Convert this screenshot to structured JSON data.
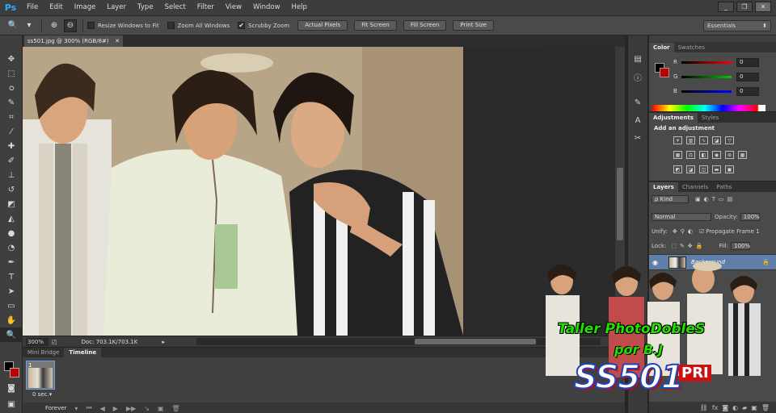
{
  "app": {
    "logo": "Ps"
  },
  "menu": [
    "File",
    "Edit",
    "Image",
    "Layer",
    "Type",
    "Select",
    "Filter",
    "View",
    "Window",
    "Help"
  ],
  "window_controls": {
    "minimize": "_",
    "restore": "❐",
    "close": "✕"
  },
  "options": {
    "resize_windows_label": "Resize Windows to Fit",
    "zoom_all_label": "Zoom All Windows",
    "scrubby_zoom_label": "Scrubby Zoom",
    "scrubby_zoom_checked": "✔",
    "actual_pixels": "Actual Pixels",
    "fit_screen": "Fit Screen",
    "fill_screen": "Fill Screen",
    "print_size": "Print Size",
    "workspace": "Essentials"
  },
  "document": {
    "tab_title": "ss501.jpg @ 300% (RGB/8#)",
    "close": "✕"
  },
  "status": {
    "zoom": "300%",
    "doc_info": "Doc: 703.1K/703.1K"
  },
  "timeline": {
    "tabs": [
      "Mini Bridge",
      "Timeline"
    ],
    "frame_number": "1",
    "frame_delay": "0 sec.▾",
    "loop": "Forever"
  },
  "color_panel": {
    "tabs": [
      "Color",
      "Swatches"
    ],
    "channels": [
      {
        "label": "R",
        "value": "0",
        "gradient": "linear-gradient(90deg,#000,#f00)"
      },
      {
        "label": "G",
        "value": "0",
        "gradient": "linear-gradient(90deg,#000,#0c0)"
      },
      {
        "label": "B",
        "value": "0",
        "gradient": "linear-gradient(90deg,#000,#00f)"
      }
    ],
    "foreground": "#000000",
    "background": "#c00000"
  },
  "adjustments": {
    "tabs": [
      "Adjustments",
      "Styles"
    ],
    "title": "Add an adjustment"
  },
  "layers": {
    "tabs": [
      "Layers",
      "Channels",
      "Paths"
    ],
    "kind": "ρ Kind",
    "blend_mode": "Normal",
    "opacity_label": "Opacity:",
    "opacity_value": "100%",
    "unify_label": "Unify:",
    "propagate_label": "Propagate Frame 1",
    "lock_label": "Lock:",
    "fill_label": "Fill:",
    "fill_value": "100%",
    "background_layer": "Background"
  },
  "watermark": {
    "title": "Taller PhotoDobleS",
    "subtitle": "por B.J",
    "logo": "SS501",
    "logo_suffix": "PRI"
  }
}
